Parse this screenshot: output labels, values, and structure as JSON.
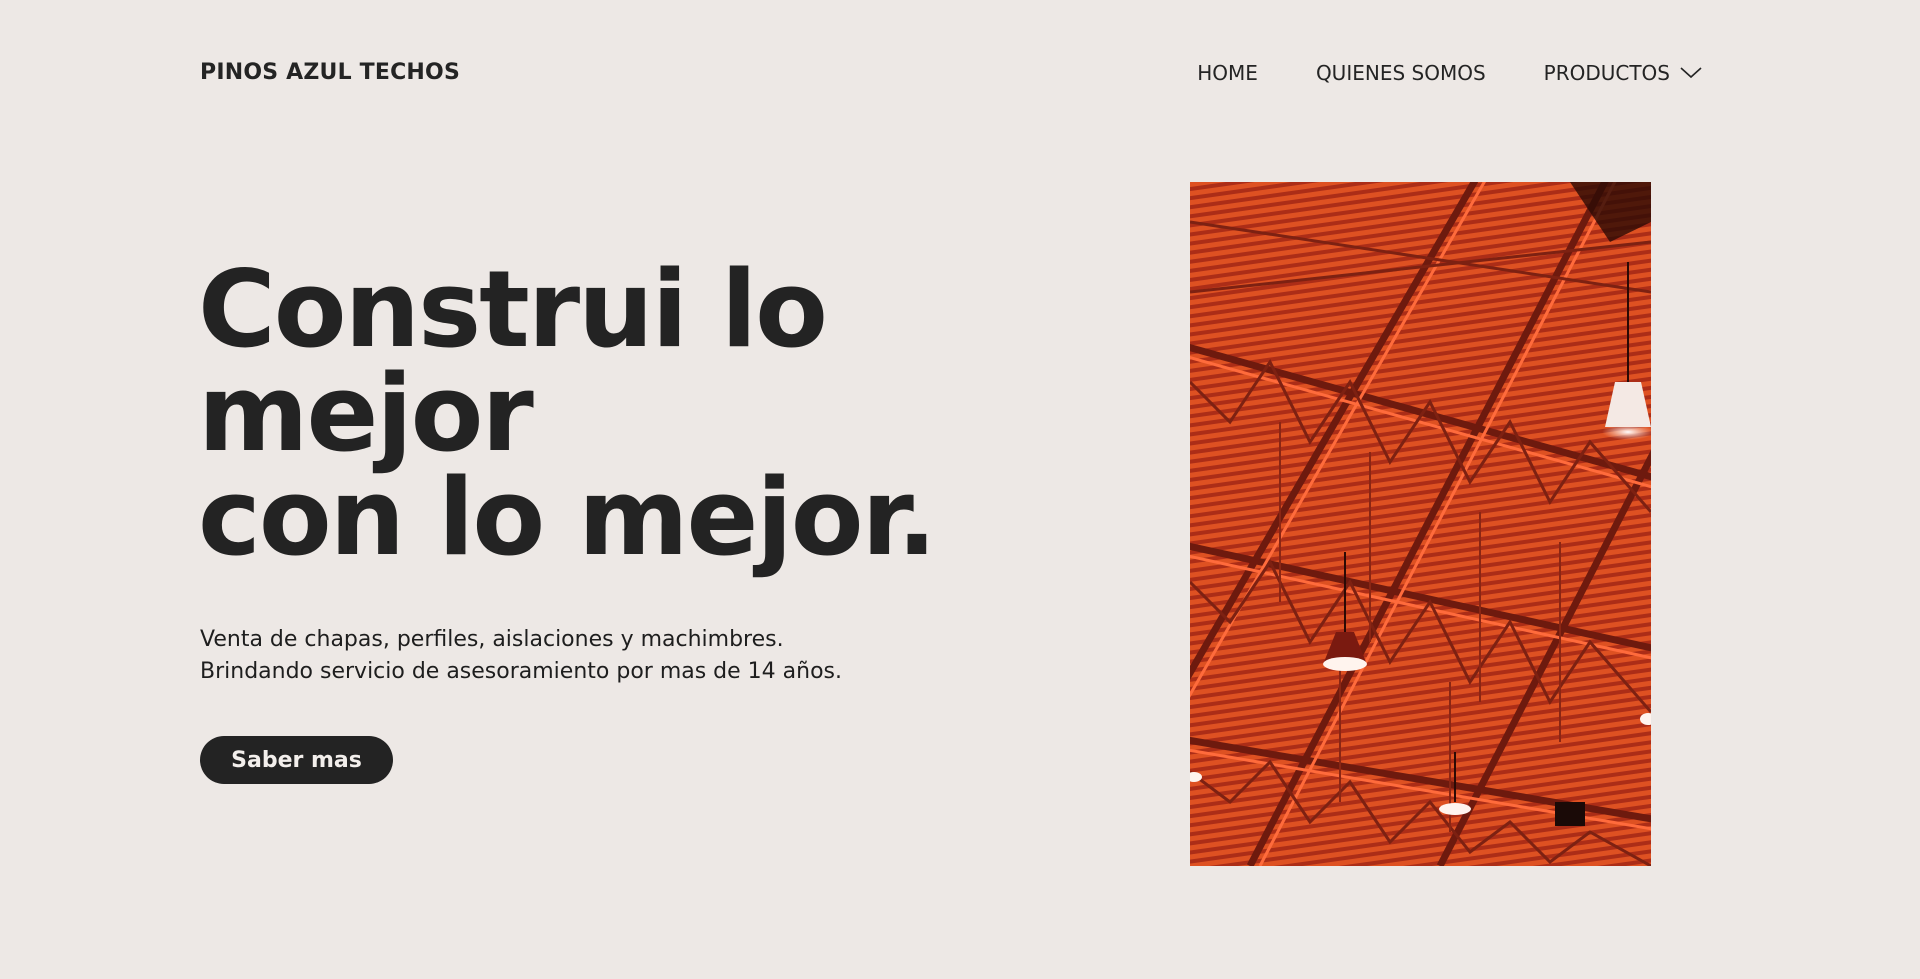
{
  "header": {
    "brand": "PINOS AZUL TECHOS",
    "nav": [
      {
        "label": "HOME"
      },
      {
        "label": "QUIENES SOMOS"
      },
      {
        "label": "PRODUCTOS",
        "icon": "chevron-down-icon"
      }
    ]
  },
  "hero": {
    "title_lines": [
      "Construi lo",
      "mejor",
      "con lo mejor."
    ],
    "description_lines": [
      "Venta de chapas, perfiles, aislaciones y machimbres.",
      "Brindando servicio de asesoramiento por mas de 14 años."
    ],
    "cta_label": "Saber mas",
    "image_alt": "Orange industrial roof structure with hanging lamps"
  },
  "colors": {
    "background": "#ede8e5",
    "text": "#242424",
    "button_bg": "#232323",
    "image_accent": "#e0461e"
  }
}
